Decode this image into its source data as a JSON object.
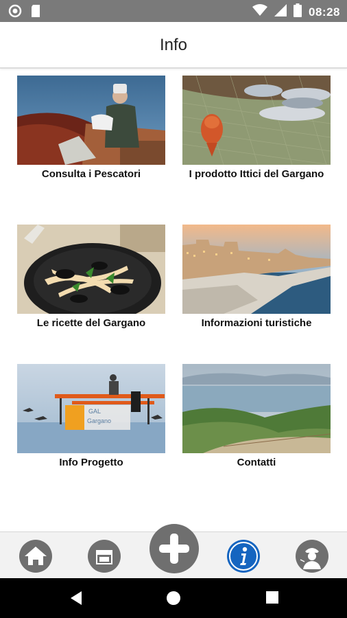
{
  "status_bar": {
    "time": "08:28",
    "icons": [
      "record-icon",
      "sd-card-icon",
      "wifi-icon",
      "signal-icon",
      "battery-icon"
    ]
  },
  "header": {
    "title": "Info"
  },
  "cards": [
    {
      "label": "Consulta i Pescatori",
      "image": "fisherman-photo"
    },
    {
      "label": "I prodotto Ittici del Gargano",
      "image": "fish-on-net-photo"
    },
    {
      "label": "Le ricette del Gargano",
      "image": "mussels-pasta-photo"
    },
    {
      "label": "Informazioni turistiche",
      "image": "coastal-town-photo"
    },
    {
      "label": "Info Progetto",
      "image": "gal-gargano-photo"
    },
    {
      "label": "Contatti",
      "image": "hills-landscape-photo"
    }
  ],
  "tab_bar": {
    "items": [
      "home-icon",
      "shop-icon",
      "add-icon",
      "info-icon",
      "fisherman-icon"
    ],
    "active": "info-icon",
    "active_color": "#1565c0",
    "inactive_color": "#6f6f6f"
  },
  "nav_bar": {
    "items": [
      "back-icon",
      "home-icon",
      "recents-icon"
    ]
  }
}
